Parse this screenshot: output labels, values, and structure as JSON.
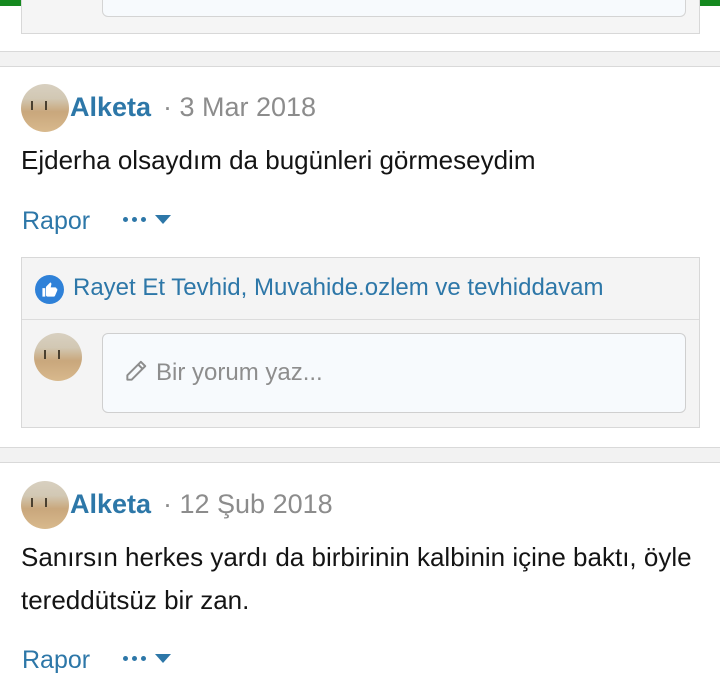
{
  "posts": [
    {
      "author": "Alketa",
      "date": "· 3 Mar 2018",
      "body": "Ejderha olsaydım da bugünleri görmeseydim",
      "report_label": "Rapor",
      "likes_text": "Rayet Et Tevhid, Muvahide.ozlem ve tevhiddavam",
      "comment_placeholder": "Bir yorum yaz..."
    },
    {
      "author": "Alketa",
      "date": "· 12 Şub 2018",
      "body": "Sanırsın herkes yardı da birbirinin kalbinin içine baktı, öyle tereddütsüz bir zan.",
      "report_label": "Rapor"
    }
  ],
  "colors": {
    "accent": "#2d77a8",
    "top_bar": "#15891f",
    "like_icon": "#2f81d8"
  },
  "icons": {
    "like": "thumbs-up-icon",
    "more": "more-options-icon",
    "pencil": "pencil-icon"
  }
}
